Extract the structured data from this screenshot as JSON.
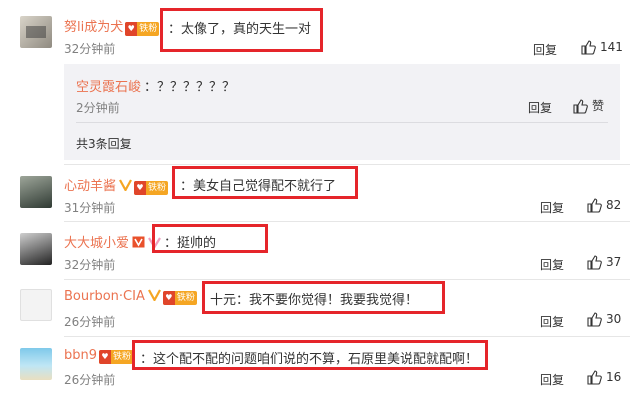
{
  "comments": [
    {
      "name": "努li成为犬",
      "text": "：太像了，真的天生一对",
      "time": "32分钟前",
      "reply": "回复",
      "likes": "141",
      "badge": "铁粉",
      "sub": {
        "name": "空灵霞石峻",
        "text": "：？？？？？？",
        "time": "2分钟前",
        "reply": "回复",
        "likes": "赞",
        "more": "共3条回复"
      }
    },
    {
      "name": "心动羊酱",
      "text": "：美女自己觉得配不就行了",
      "time": "31分钟前",
      "reply": "回复",
      "likes": "82",
      "badge": "铁粉"
    },
    {
      "name": "大大城小爱",
      "text": "：挺帅的",
      "time": "32分钟前",
      "reply": "回复",
      "likes": "37"
    },
    {
      "name": "Bourbon·CIA",
      "text": "十元：我不要你觉得！我要我觉得！",
      "time": "26分钟前",
      "reply": "回复",
      "likes": "30",
      "badge": "铁粉"
    },
    {
      "name": "bbn9",
      "text": "：这个配不配的问题咱们说的不算，石原里美说配就配啊！",
      "time": "26分钟前",
      "reply": "回复",
      "likes": "16",
      "badge": "铁粉"
    }
  ],
  "colors": {
    "name": "#eb7350",
    "highlight": "#e5252a",
    "badge": "#f5a623",
    "subbg": "#f2f2f5"
  }
}
